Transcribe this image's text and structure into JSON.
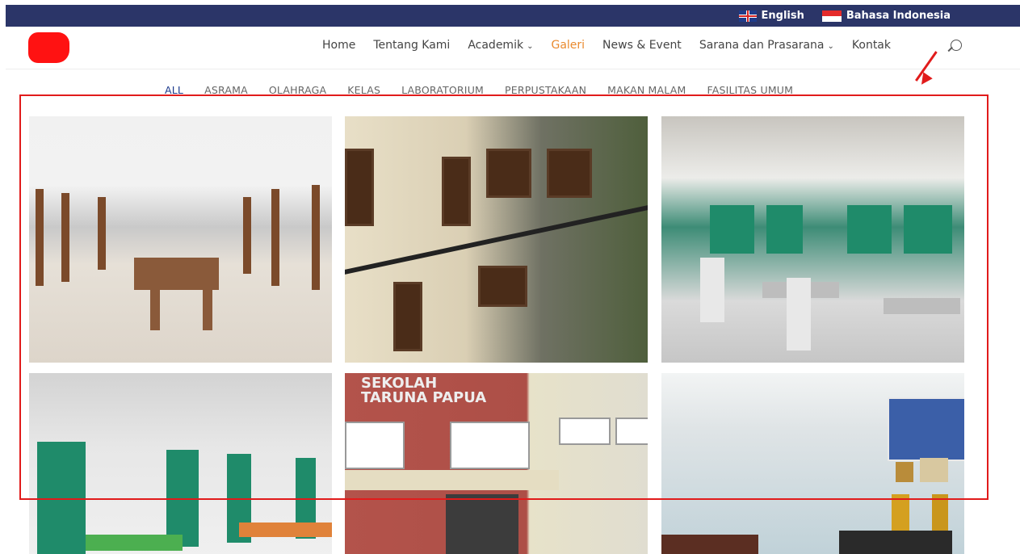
{
  "topbar": {
    "lang_en": "English",
    "lang_id": "Bahasa Indonesia"
  },
  "nav": {
    "items": [
      {
        "label": "Home"
      },
      {
        "label": "Tentang Kami"
      },
      {
        "label": "Academik"
      },
      {
        "label": "Galeri"
      },
      {
        "label": "News & Event"
      },
      {
        "label": "Sarana dan Prasarana"
      },
      {
        "label": "Kontak"
      }
    ]
  },
  "filters": {
    "items": [
      "ALL",
      "ASRAMA",
      "OLAHRAGA",
      "KELAS",
      "LABORATORIUM",
      "PERPUSTAKAAN",
      "MAKAN MALAM",
      "FASILITAS UMUM"
    ],
    "selected": "ALL"
  },
  "gallery": {
    "school_sign_line1": "SEKOLAH",
    "school_sign_line2": "TARUNA PAPUA"
  },
  "colors": {
    "topbar_bg": "#2b3568",
    "active_nav": "#e98a2e",
    "highlight": "#e11b1b"
  }
}
